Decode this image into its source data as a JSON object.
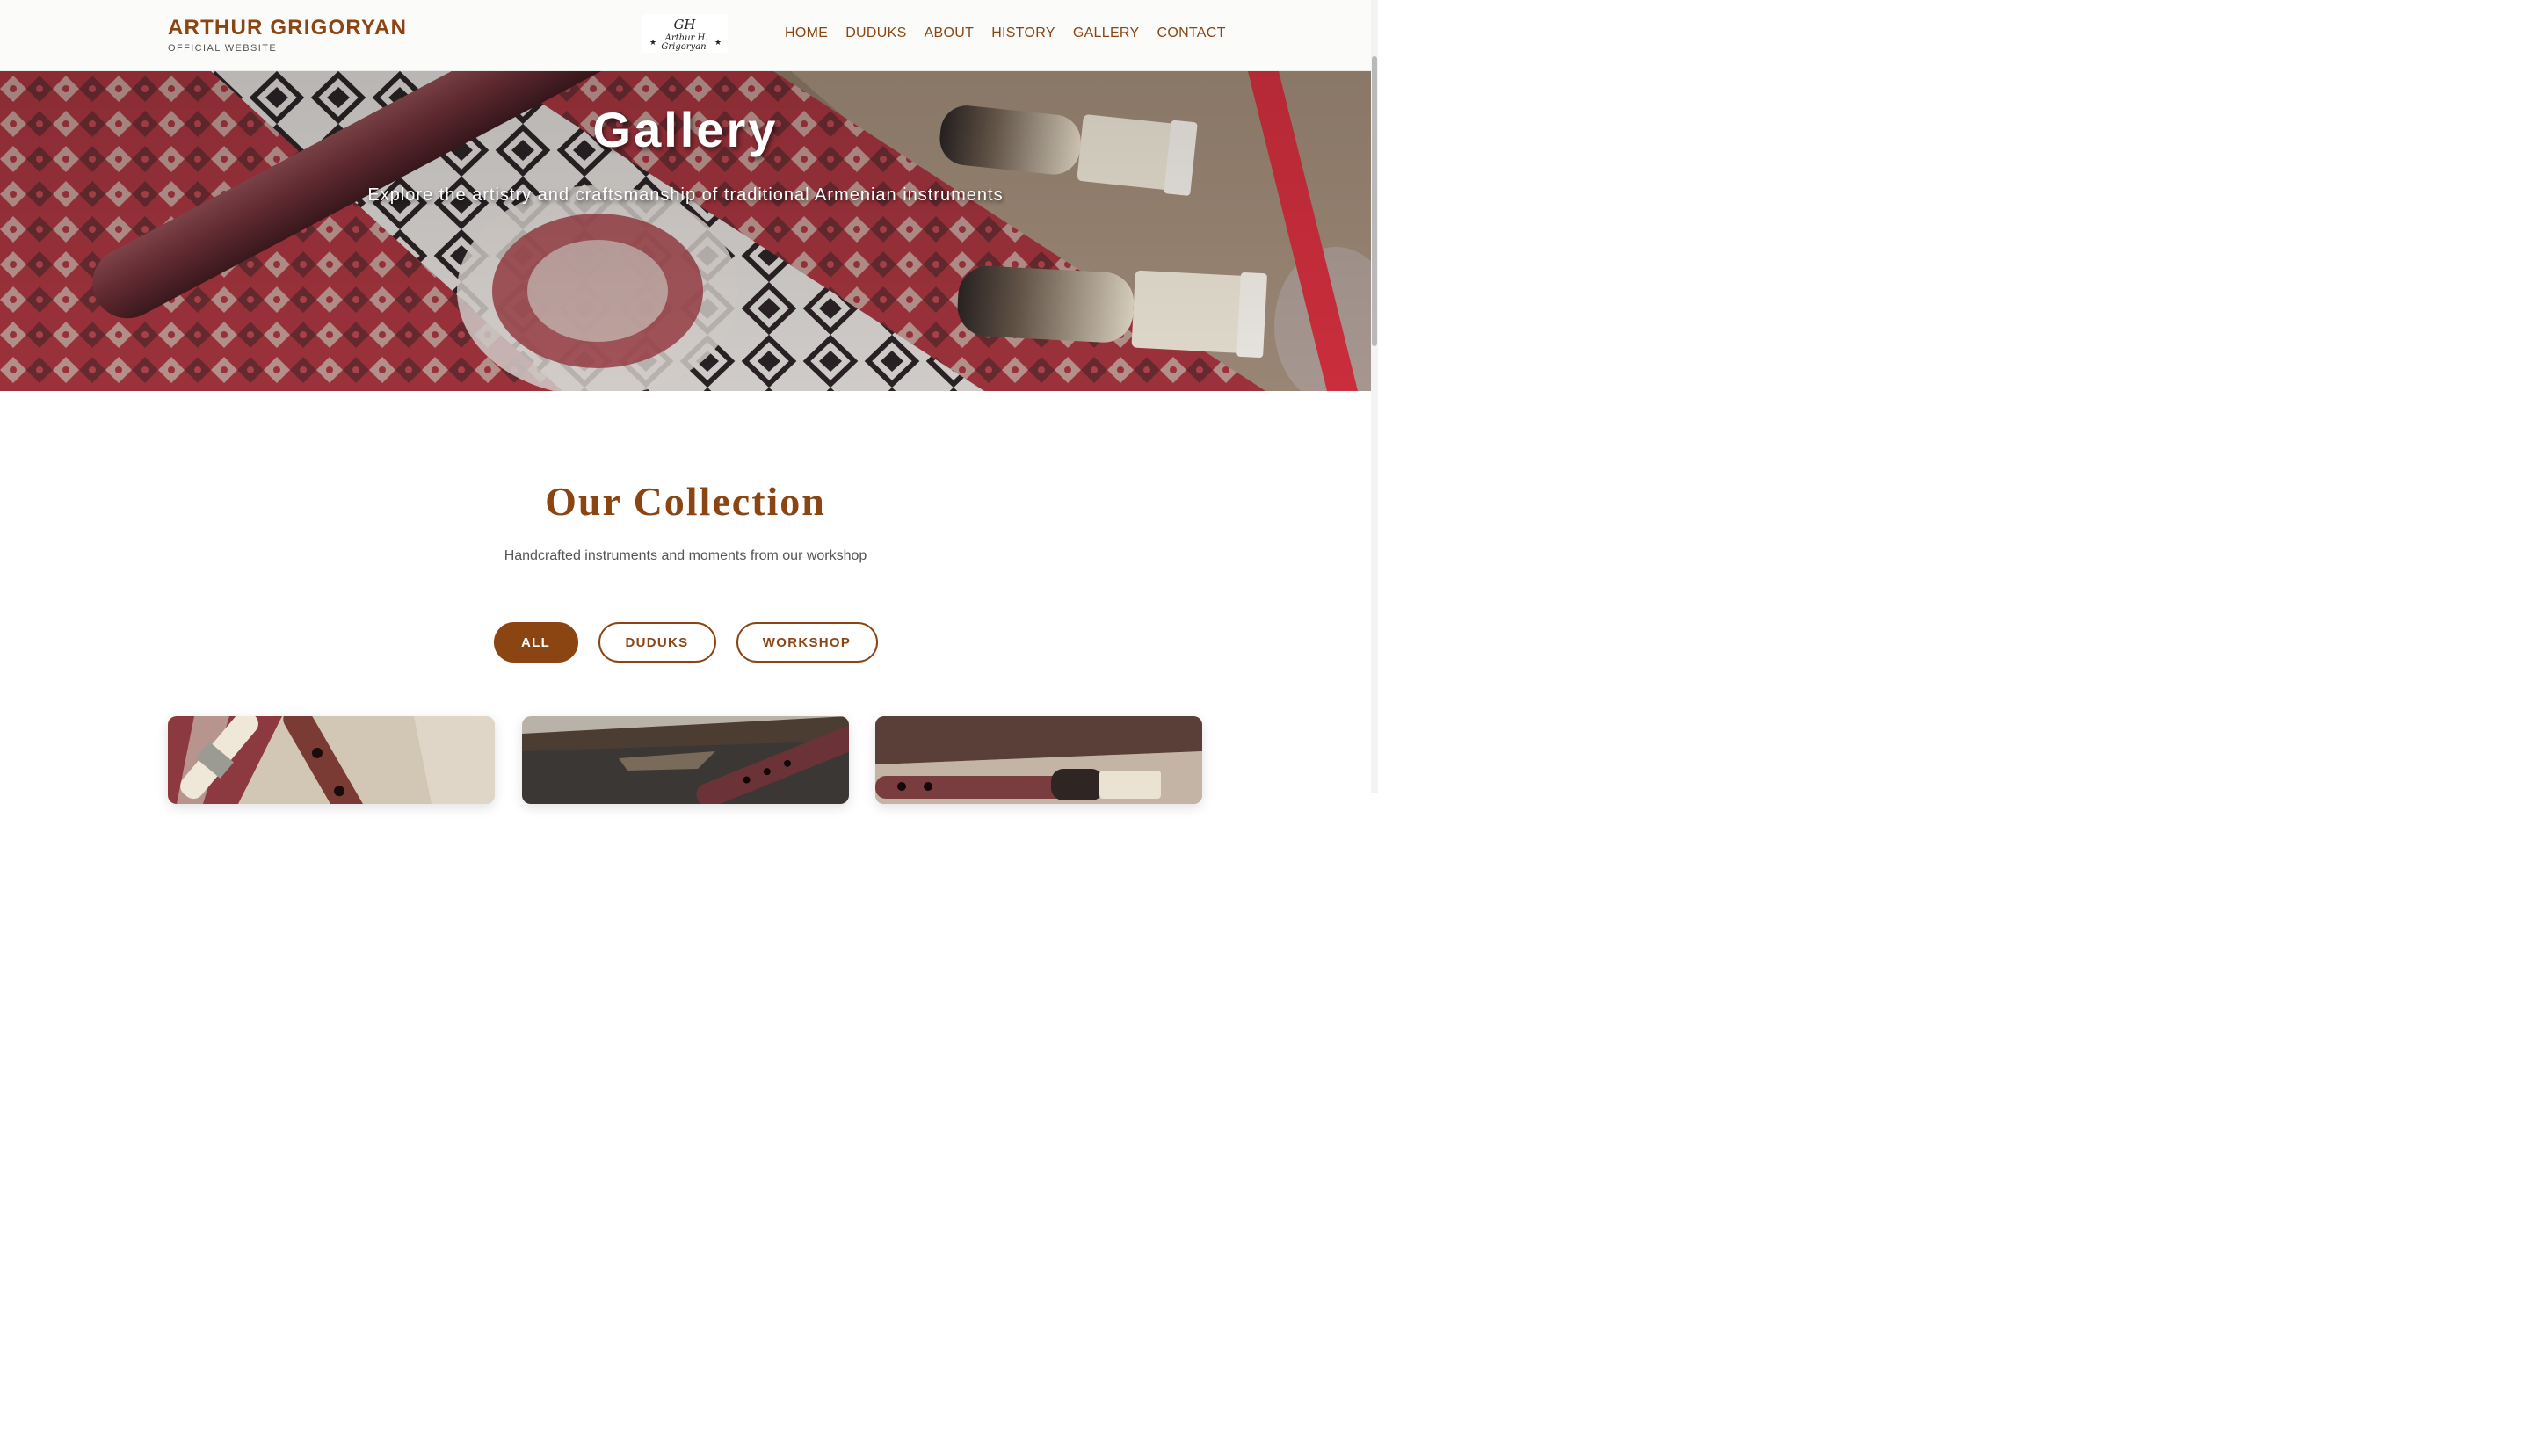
{
  "header": {
    "brand_name": "ARTHUR GRIGORYAN",
    "brand_sub": "OFFICIAL WEBSITE",
    "logo": {
      "monogram": "GH",
      "line1": "Arthur H.",
      "line2": "Grigoryan"
    },
    "nav": [
      "HOME",
      "DUDUKS",
      "ABOUT",
      "HISTORY",
      "GALLERY",
      "CONTACT"
    ]
  },
  "hero": {
    "title": "Gallery",
    "subtitle": "Explore the artistry and craftsmanship of traditional Armenian instruments"
  },
  "collection": {
    "title": "Our Collection",
    "subtitle": "Handcrafted instruments and moments from our workshop",
    "filters": [
      {
        "label": "ALL",
        "active": true
      },
      {
        "label": "DUDUKS",
        "active": false
      },
      {
        "label": "WORKSHOP",
        "active": false
      }
    ]
  },
  "colors": {
    "brand": "#8b4513",
    "text_muted": "#555555",
    "header_bg": "#fbfbfa"
  }
}
